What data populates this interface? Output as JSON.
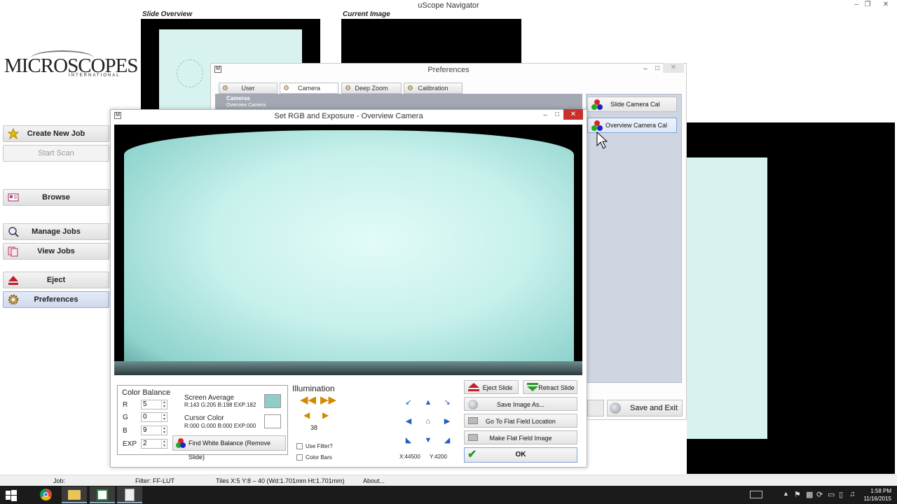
{
  "window": {
    "title": "uScope Navigator"
  },
  "logo": {
    "text": "MICROSCOPES",
    "sub": "INTERNATIONAL"
  },
  "panels": {
    "slide_overview": "Slide Overview",
    "current_image": "Current Image"
  },
  "nav": {
    "create_job": "Create New Job",
    "start_scan": "Start Scan",
    "browse": "Browse",
    "manage_jobs": "Manage Jobs",
    "view_jobs": "View Jobs",
    "eject": "Eject",
    "preferences": "Preferences"
  },
  "preferences": {
    "title": "Preferences",
    "tabs": [
      "User",
      "Camera",
      "Deep Zoom",
      "Calibration"
    ],
    "tree": [
      "Cameras",
      "Overview Camera"
    ],
    "slide_camera_cal": "Slide Camera Cal",
    "overview_camera_cal": "Overview Camera Cal",
    "save_and_exit": "Save and Exit"
  },
  "rgb_dialog": {
    "title": "Set RGB and Exposure - Overview Camera",
    "color_balance": {
      "title": "Color Balance",
      "r_label": "R",
      "r_value": "5",
      "g_label": "G",
      "g_value": "0",
      "b_label": "B",
      "b_value": "9",
      "exp_label": "EXP",
      "exp_value": "2"
    },
    "screen_average": {
      "label": "Screen Average",
      "value": "R:143 G:205 B:198 EXP:182",
      "color": "#8fcdc6"
    },
    "cursor_color": {
      "label": "Cursor Color",
      "value": "R:000 G:000 B:000 EXP:000",
      "color": "#ffffff"
    },
    "white_balance_button": "Find White Balance (Remove Slide)",
    "illumination": {
      "title": "Illumination",
      "value": "38"
    },
    "use_filter": "Use Filter?",
    "color_bars": "Color Bars",
    "coords": {
      "x": "X:44500",
      "y": "Y:4200"
    },
    "eject_slide": "Eject Slide",
    "retract_slide": "Retract Slide",
    "save_image_as": "Save Image As...",
    "go_flat_field": "Go To Flat Field Location",
    "make_flat_field": "Make Flat Field Image",
    "ok": "OK"
  },
  "status_bar": {
    "job": "Job:",
    "filter": "Filter: FF-LUT",
    "tiles": "Tiles X:5 Y:8 – 40 (Wd:1.701mm Ht:1.701mm)",
    "about": "About..."
  },
  "taskbar": {
    "time": "1:58 PM",
    "date": "11/16/2015"
  }
}
